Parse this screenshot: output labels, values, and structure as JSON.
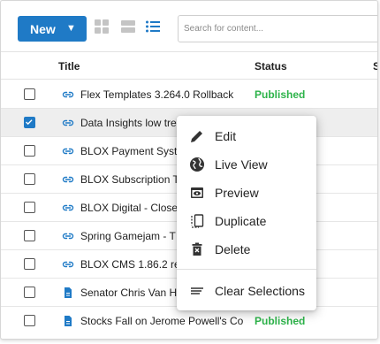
{
  "toolbar": {
    "new_label": "New",
    "new_caret": "▼",
    "search_placeholder": "Search for content..."
  },
  "table": {
    "headers": {
      "title": "Title",
      "status": "Status",
      "extra": "S"
    },
    "rows": [
      {
        "title": "Flex Templates 3.264.0 Rollback",
        "status": "Published",
        "checked": false,
        "icon": "link-icon"
      },
      {
        "title": "Data Insights low tre",
        "status": "",
        "checked": true,
        "icon": "link-icon"
      },
      {
        "title": "BLOX Payment Syst",
        "status": "",
        "checked": false,
        "icon": "link-icon"
      },
      {
        "title": "BLOX Subscription T",
        "status": "",
        "checked": false,
        "icon": "link-icon"
      },
      {
        "title": "BLOX Digital - Close",
        "status": "",
        "checked": false,
        "icon": "link-icon"
      },
      {
        "title": "Spring Gamejam - T",
        "status": "",
        "checked": false,
        "icon": "link-icon"
      },
      {
        "title": "BLOX CMS 1.86.2 re",
        "status": "",
        "checked": false,
        "icon": "link-icon"
      },
      {
        "title": "Senator Chris Van H",
        "status": "",
        "checked": false,
        "icon": "document-icon"
      },
      {
        "title": "Stocks Fall on Jerome Powell's Co",
        "status": "Published",
        "checked": false,
        "icon": "document-icon"
      }
    ]
  },
  "context_menu": {
    "items": [
      {
        "label": "Edit",
        "icon": "pencil-icon"
      },
      {
        "label": "Live View",
        "icon": "globe-icon"
      },
      {
        "label": "Preview",
        "icon": "preview-icon"
      },
      {
        "label": "Duplicate",
        "icon": "duplicate-icon"
      },
      {
        "label": "Delete",
        "icon": "trash-icon"
      },
      {
        "label": "Clear Selections",
        "icon": "clear-lines-icon"
      }
    ]
  },
  "colors": {
    "accent": "#1f7ac6",
    "published": "#2db34a",
    "selected_row": "#eeeeee"
  }
}
